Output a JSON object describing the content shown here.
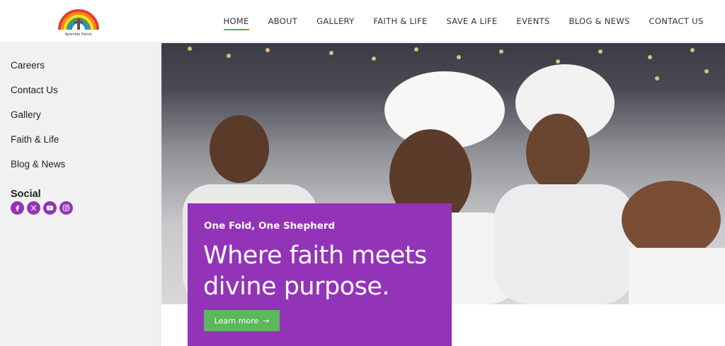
{
  "logo": {
    "caption": "Ayomide Parish",
    "alt": "parish-logo"
  },
  "nav": {
    "items": [
      {
        "label": "HOME",
        "active": true
      },
      {
        "label": "ABOUT"
      },
      {
        "label": "GALLERY"
      },
      {
        "label": "FAITH & LIFE"
      },
      {
        "label": "SAVE A LIFE"
      },
      {
        "label": "EVENTS"
      },
      {
        "label": "BLOG & NEWS"
      },
      {
        "label": "CONTACT US"
      }
    ]
  },
  "sidebar": {
    "links": [
      {
        "label": "Careers"
      },
      {
        "label": "Contact Us"
      },
      {
        "label": "Gallery"
      },
      {
        "label": "Faith & Life"
      },
      {
        "label": "Blog & News"
      }
    ],
    "social_title": "Social",
    "social_icons": [
      "facebook-icon",
      "x-icon",
      "youtube-icon",
      "instagram-icon"
    ]
  },
  "hero": {
    "kicker": "One Fold, One Shepherd",
    "title": "Where faith meets divine purpose.",
    "button_label": "Learn more",
    "button_arrow": "→"
  },
  "colors": {
    "accent": "#9333b8",
    "nav_active": "#4caf50",
    "button": "#5cb85c"
  }
}
